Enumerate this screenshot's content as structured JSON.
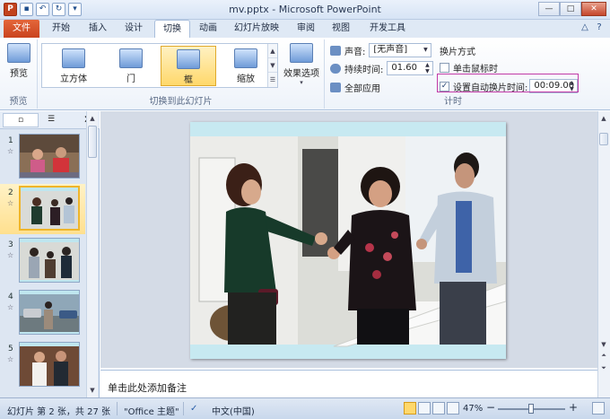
{
  "window": {
    "title": "mv.pptx - Microsoft PowerPoint"
  },
  "tabs": [
    {
      "label": "文件"
    },
    {
      "label": "开始"
    },
    {
      "label": "插入"
    },
    {
      "label": "设计"
    },
    {
      "label": "切换"
    },
    {
      "label": "动画"
    },
    {
      "label": "幻灯片放映"
    },
    {
      "label": "审阅"
    },
    {
      "label": "视图"
    },
    {
      "label": "开发工具"
    }
  ],
  "ribbon": {
    "preview": {
      "button_label": "预览",
      "group_label": "预览"
    },
    "transitions": {
      "gallery": [
        {
          "label": "立方体"
        },
        {
          "label": "门"
        },
        {
          "label": "框"
        },
        {
          "label": "缩放"
        }
      ],
      "selected": "框",
      "effects_label": "效果选项",
      "group_label": "切换到此幻灯片"
    },
    "timing": {
      "sound_label": "声音:",
      "sound_value": "[无声音]",
      "duration_label": "持续时间:",
      "duration_value": "01.60",
      "apply_all_label": "全部应用",
      "advance_heading": "换片方式",
      "on_click_label": "单击鼠标时",
      "on_click_checked": false,
      "auto_label": "设置自动换片时间:",
      "auto_checked": true,
      "auto_value": "00:09.00",
      "group_label": "计时"
    }
  },
  "slides": [
    {
      "number": "1"
    },
    {
      "number": "2"
    },
    {
      "number": "3"
    },
    {
      "number": "4"
    },
    {
      "number": "5"
    }
  ],
  "current_slide": 2,
  "notes_placeholder": "单击此处添加备注",
  "status": {
    "slide_info": "幻灯片 第 2 张，共 27 张",
    "theme": "\"Office 主题\"",
    "language": "中文(中国)",
    "zoom": "47%"
  },
  "colors": {
    "file_tab": "#d24f26",
    "accent": "#c23aa8",
    "selected": "#ffd86b"
  }
}
